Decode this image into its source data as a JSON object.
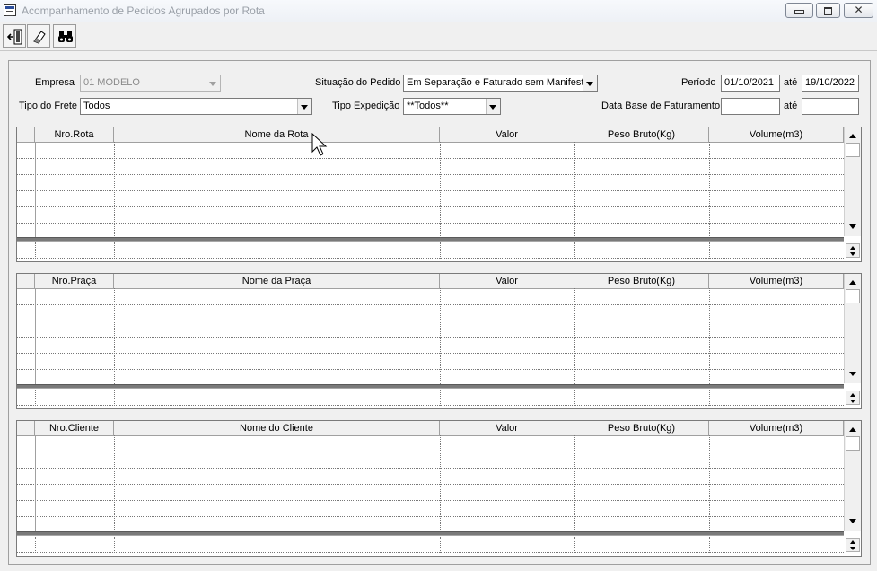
{
  "window": {
    "title": "Acompanhamento de Pedidos Agrupados por Rota"
  },
  "toolbar": {
    "exit_icon": "exit-door-icon",
    "clear_icon": "eraser-icon",
    "search_icon": "binoculars-icon"
  },
  "filters": {
    "empresa_label": "Empresa",
    "empresa_value": "01 MODELO",
    "situacao_label": "Situação do Pedido",
    "situacao_value": "Em Separação e Faturado sem Manifesto",
    "periodo_label": "Período",
    "periodo_inicio": "01/10/2021",
    "ate_label": "até",
    "periodo_fim": "19/10/2022",
    "tipo_frete_label": "Tipo do Frete",
    "tipo_frete_value": "Todos",
    "tipo_expedicao_label": "Tipo Expedição",
    "tipo_expedicao_value": "**Todos**",
    "data_base_label": "Data Base de Faturamento",
    "data_base_inicio": "",
    "ate2_label": "até",
    "data_base_fim": ""
  },
  "grids": {
    "rota": {
      "columns": [
        "Nro.Rota",
        "Nome da Rota",
        "Valor",
        "Peso Bruto(Kg)",
        "Volume(m3)"
      ]
    },
    "praca": {
      "columns": [
        "Nro.Praça",
        "Nome da Praça",
        "Valor",
        "Peso Bruto(Kg)",
        "Volume(m3)"
      ]
    },
    "cliente": {
      "columns": [
        "Nro.Cliente",
        "Nome do Cliente",
        "Valor",
        "Peso Bruto(Kg)",
        "Volume(m3)"
      ]
    }
  }
}
